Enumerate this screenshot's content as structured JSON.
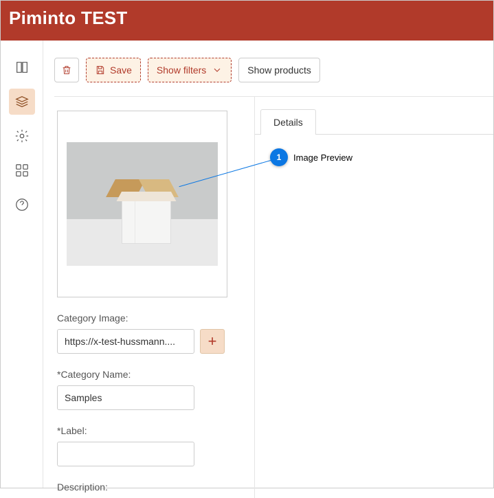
{
  "header": {
    "title": "Piminto TEST"
  },
  "toolbar": {
    "save_label": "Save",
    "show_filters_label": "Show filters",
    "show_products_label": "Show products"
  },
  "form": {
    "category_image_label": "Category Image:",
    "category_image_value": "https://x-test-hussmann....",
    "category_name_label": "*Category Name:",
    "category_name_value": "Samples",
    "label_label": "*Label:",
    "label_value": "",
    "description_label": "Description:"
  },
  "tabs": {
    "details_label": "Details"
  },
  "annotation": {
    "number": "1",
    "text": "Image Preview"
  }
}
